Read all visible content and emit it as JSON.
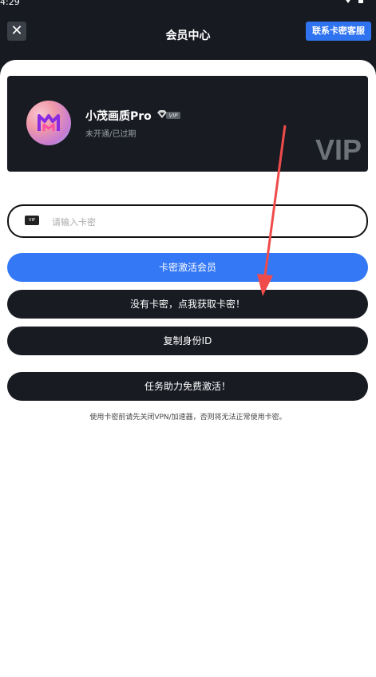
{
  "status_bar": {
    "time": "4:29"
  },
  "header": {
    "close_icon": "close-icon",
    "title": "会员中心",
    "service_button": "联系卡密客服"
  },
  "vip_card": {
    "user_name": "小茂画质Pro",
    "badge": "VIP",
    "status": "未开通/已过期",
    "watermark": "VIP"
  },
  "code_input": {
    "icon_label": "VIP",
    "placeholder": "请输入卡密",
    "value": ""
  },
  "buttons": {
    "activate": "卡密激活会员",
    "get_code": "没有卡密，点我获取卡密！",
    "copy_id": "复制身份ID",
    "task": "任务助力免费激活！"
  },
  "tip": "使用卡密前请先关闭VPN/加速器，否则将无法正常使用卡密。",
  "colors": {
    "accent": "#3478f6",
    "dark": "#181b22",
    "annotation_arrow": "#f04b4b"
  }
}
